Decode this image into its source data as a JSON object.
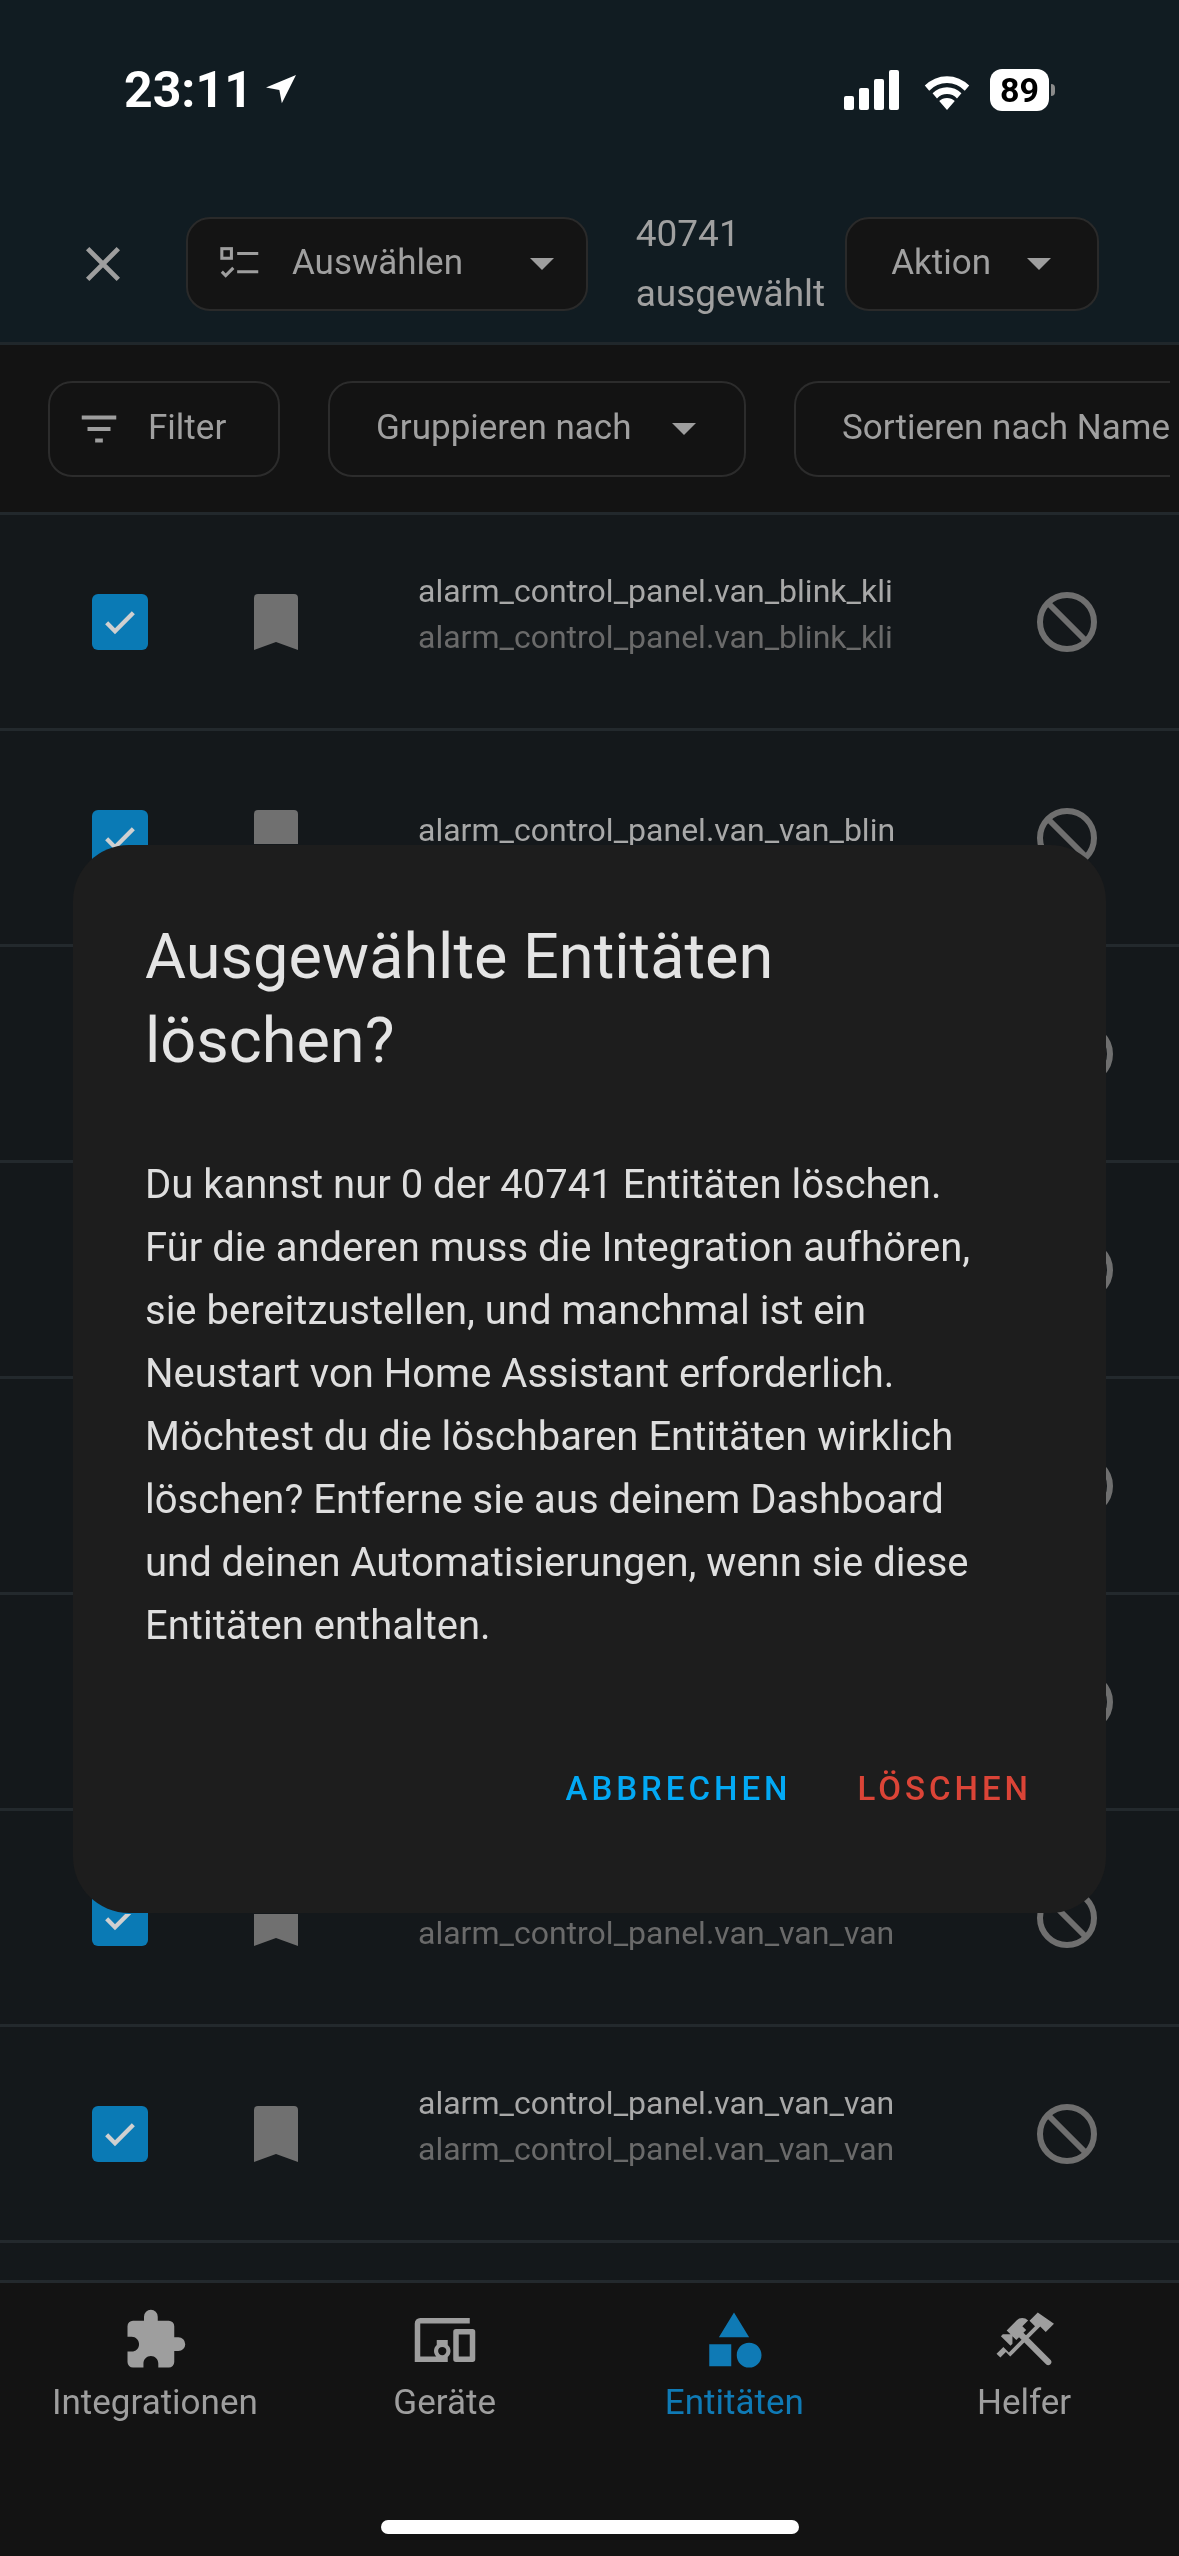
{
  "status_bar": {
    "time": "23:11",
    "battery": "89"
  },
  "toolbar": {
    "select_button": "Auswählen",
    "count": "40741",
    "count_label": "ausgewählt",
    "action_button": "Aktion"
  },
  "filter_bar": {
    "filter": "Filter",
    "group": "Gruppieren nach",
    "sort": "Sortieren nach Name"
  },
  "rows": [
    {
      "kind": "entity",
      "checked": true,
      "primary": "alarm_control_panel.van_blink_kli",
      "secondary": "alarm_control_panel.van_blink_kli"
    },
    {
      "kind": "entity",
      "checked": true,
      "primary": "alarm_control_panel.van_van_blin"
    },
    {
      "kind": "covered"
    },
    {
      "kind": "covered"
    },
    {
      "kind": "covered"
    },
    {
      "kind": "covered"
    },
    {
      "kind": "entity",
      "checked": true,
      "secondary": "alarm_control_panel.van_van_van"
    },
    {
      "kind": "entity",
      "checked": true,
      "primary": "alarm_control_panel.van_van_van",
      "secondary": "alarm_control_panel.van_van_van"
    }
  ],
  "dialog": {
    "title": "Ausgewählte Entitäten löschen?",
    "body": "Du kannst nur 0 der 40741 Entitäten löschen. Für die anderen muss die Integration aufhören, sie bereitzustellen, und manchmal ist ein Neustart von Home Assistant erforderlich. Möchtest du die löschbaren Entitäten wirklich löschen? Entferne sie aus deinem Dashboard und deinen Automatisierungen, wenn sie diese Entitäten enthalten.",
    "cancel": "ABBRECHEN",
    "confirm": "LÖSCHEN"
  },
  "nav": [
    {
      "kind": "integrations",
      "label": "Integrationen",
      "selected": false
    },
    {
      "kind": "devices",
      "label": "Geräte",
      "selected": false
    },
    {
      "kind": "entities",
      "label": "Entitäten",
      "selected": true
    },
    {
      "kind": "helpers",
      "label": "Helfer",
      "selected": false
    }
  ]
}
